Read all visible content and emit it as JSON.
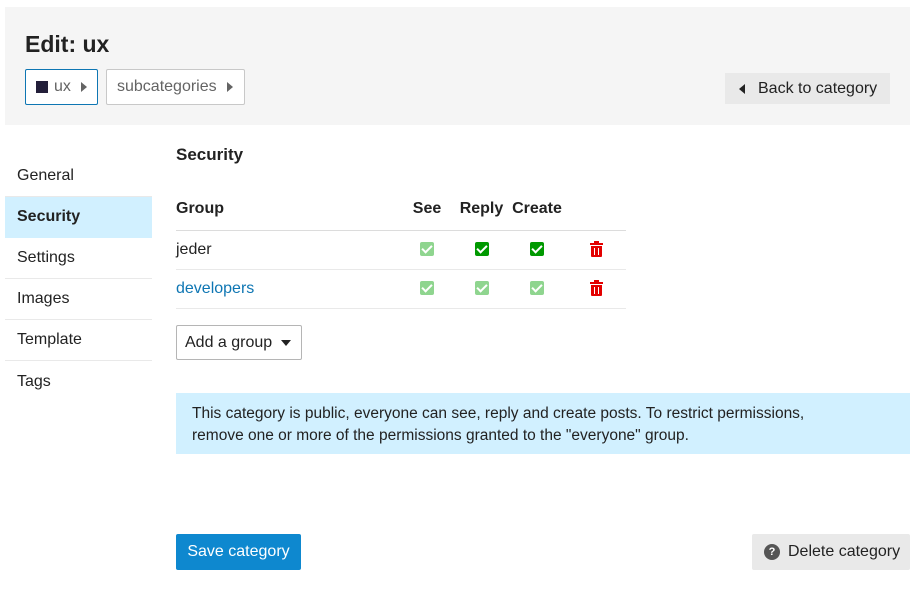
{
  "header": {
    "title": "Edit: ux",
    "breadcrumbs": [
      {
        "label": "ux",
        "color": "#231f3a"
      },
      {
        "label": "subcategories"
      }
    ],
    "back_label": "Back to category"
  },
  "sidebar": {
    "items": [
      {
        "label": "General"
      },
      {
        "label": "Security",
        "active": true
      },
      {
        "label": "Settings"
      },
      {
        "label": "Images"
      },
      {
        "label": "Template"
      },
      {
        "label": "Tags"
      }
    ]
  },
  "security": {
    "title": "Security",
    "columns": [
      "Group",
      "See",
      "Reply",
      "Create"
    ],
    "rows": [
      {
        "group": "jeder",
        "see": "inherited",
        "reply": "granted",
        "create": "granted"
      },
      {
        "group": "developers",
        "see": "inherited",
        "reply": "inherited",
        "create": "inherited"
      }
    ],
    "add_group_label": "Add a group",
    "notice_line1": "This category is public, everyone can see, reply and create posts. To restrict permissions,",
    "notice_line2": "remove one or more of the permissions granted to the \"everyone\" group."
  },
  "footer": {
    "save_label": "Save category",
    "delete_label": "Delete category",
    "delete_icon": "question-icon"
  },
  "colors": {
    "accent": "#0e88cf",
    "link": "#0e76b3",
    "active_bg": "#d1f0ff",
    "check_granted": "#009900",
    "check_inherited": "#8fd58f",
    "danger": "#e30000"
  }
}
